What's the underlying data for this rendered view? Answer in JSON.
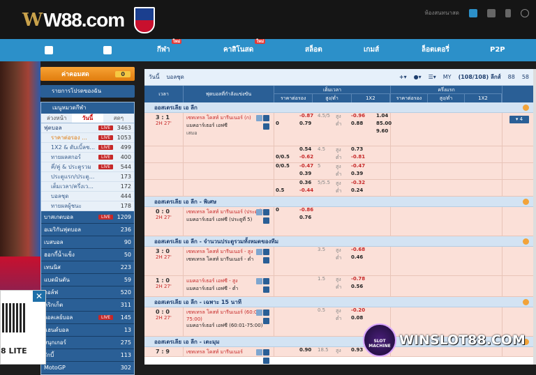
{
  "brand": {
    "name": "W88.com",
    "mark": "W"
  },
  "topbar": {
    "support_text": "ห้องสนทนาสด"
  },
  "nav": {
    "items": [
      {
        "label": "",
        "icon": "home-icon"
      },
      {
        "label": "",
        "icon": "mobile-icon"
      },
      {
        "label": "กีฬา",
        "badge": "ใหม่"
      },
      {
        "label": "คาสิโนสด",
        "badge": "ใหม่"
      },
      {
        "label": "สล็อต"
      },
      {
        "label": "เกมส์"
      },
      {
        "label": "ล็อตเตอรี่"
      },
      {
        "label": "P2P"
      }
    ]
  },
  "sidebar": {
    "balance_label": "ค่าคอมสด",
    "balance_count": "0",
    "fav_label": "รายการโปรดของฉัน",
    "sports_menu": "เมนูหมวดกีฬา",
    "tabs": [
      "ล่วงหน้า",
      "วันนี้",
      "สดๆ"
    ],
    "items": [
      {
        "name": "ฟุตบอล",
        "live": "LIVE",
        "count": "3463",
        "type": "main"
      },
      {
        "name": "ราคาต่อรอง ...",
        "live": "LIVE",
        "count": "1053",
        "type": "sub-sel"
      },
      {
        "name": "1X2 & ดับเบิ้ลช...",
        "live": "LIVE",
        "count": "499",
        "type": "sub"
      },
      {
        "name": "ทายผลสกอร์",
        "live": "LIVE",
        "count": "400",
        "type": "sub"
      },
      {
        "name": "คี่/คู่ & ประตูรวม",
        "live": "LIVE",
        "count": "544",
        "type": "sub"
      },
      {
        "name": "ประตูแรก/ประตู...",
        "live": "",
        "count": "173",
        "type": "sub"
      },
      {
        "name": "เต็มเวลา/ครึ่งเว...",
        "live": "",
        "count": "172",
        "type": "sub"
      },
      {
        "name": "บอลชุด",
        "live": "",
        "count": "444",
        "type": "sub"
      },
      {
        "name": "ทายผลผู้ชนะ",
        "live": "",
        "count": "178",
        "type": "sub"
      },
      {
        "name": "บาสเกตบอล",
        "live": "LIVE",
        "count": "1209",
        "type": "big"
      },
      {
        "name": "อเมริกันฟุตบอล",
        "live": "",
        "count": "236",
        "type": "big"
      },
      {
        "name": "เบสบอล",
        "live": "",
        "count": "90",
        "type": "big"
      },
      {
        "name": "ฮอกกี้น้ำแข็ง",
        "live": "",
        "count": "50",
        "type": "big"
      },
      {
        "name": "เทนนิส",
        "live": "",
        "count": "223",
        "type": "big"
      },
      {
        "name": "แบดมินตัน",
        "live": "",
        "count": "59",
        "type": "big"
      },
      {
        "name": "กอล์ฟ",
        "live": "",
        "count": "520",
        "type": "big"
      },
      {
        "name": "คริกเก็ต",
        "live": "",
        "count": "311",
        "type": "big"
      },
      {
        "name": "วอลเลย์บอล",
        "live": "LIVE",
        "count": "145",
        "type": "big"
      },
      {
        "name": "แฮนด์บอล",
        "live": "",
        "count": "13",
        "type": "big"
      },
      {
        "name": "สนุกเกอร์",
        "live": "",
        "count": "275",
        "type": "big"
      },
      {
        "name": "รักบี้",
        "live": "",
        "count": "113",
        "type": "big"
      },
      {
        "name": "MotoGP",
        "live": "",
        "count": "302",
        "type": "big"
      }
    ]
  },
  "promo": {
    "close": "✕",
    "label": "8 LITE"
  },
  "toolbar": {
    "date": "วันนี้",
    "market": "บอลชุด",
    "odds_type": "MY",
    "count": "(108/108) ลีกส์",
    "n1": "88",
    "n2": "58"
  },
  "table_head": {
    "time": "เวลา",
    "match": "ฟุตบอลที่กำลังแข่งขัน",
    "full": "เต็มเวลา",
    "half": "ครึ่งแรก",
    "sub": [
      "ราคาต่อรอง",
      "สูง/ต่ำ",
      "1X2",
      "ราคาต่อรอง",
      "สูง/ต่ำ",
      "1X2"
    ]
  },
  "leagues": [
    {
      "name": "ออสเตรเลีย เอ ลีก",
      "rows": [
        {
          "score": "3 : 1",
          "min": "2H 27'",
          "home": "เซทเทรล โคสท์ มารีนเนอร์ (ก)",
          "away": "แมคอาร์เธอร์ เอฟซี",
          "draw": "เสมอ",
          "lines": [
            {
              "h": "",
              "o": "-0.87",
              "ou": "4.5/5",
              "ous": "สูง",
              "ouo": "-0.96",
              "x": "1.04"
            },
            {
              "h": "0",
              "o": "0.79",
              "ou": "",
              "ous": "ต่ำ",
              "ouo": "0.88",
              "x": "85.00"
            },
            {
              "h": "",
              "o": "",
              "ou": "",
              "ous": "",
              "ouo": "",
              "x": "9.60"
            }
          ],
          "more": "▾ 4",
          "hgt": 48
        },
        {
          "score": "",
          "min": "",
          "home": "",
          "away": "",
          "draw": "",
          "lines": [
            {
              "h": "",
              "o": "0.54",
              "ou": "4.5",
              "ous": "สูง",
              "ouo": "0.73",
              "x": ""
            },
            {
              "h": "0/0.5",
              "o": "-0.62",
              "ou": "",
              "ous": "ต่ำ",
              "ouo": "-0.81",
              "x": ""
            }
          ],
          "more": "",
          "hgt": 24
        },
        {
          "score": "",
          "min": "",
          "home": "",
          "away": "",
          "draw": "",
          "lines": [
            {
              "h": "0/0.5",
              "o": "-0.47",
              "ou": "5",
              "ous": "สูง",
              "ouo": "-0.47",
              "x": ""
            },
            {
              "h": "",
              "o": "0.39",
              "ou": "",
              "ous": "ต่ำ",
              "ouo": "0.39",
              "x": ""
            }
          ],
          "more": "",
          "hgt": 24
        },
        {
          "score": "",
          "min": "",
          "home": "",
          "away": "",
          "draw": "",
          "lines": [
            {
              "h": "",
              "o": "0.36",
              "ou": "5/5.5",
              "ous": "สูง",
              "ouo": "-0.32",
              "x": ""
            },
            {
              "h": "0.5",
              "o": "-0.44",
              "ou": "",
              "ous": "ต่ำ",
              "ouo": "0.24",
              "x": ""
            }
          ],
          "more": "",
          "hgt": 24
        }
      ]
    },
    {
      "name": "ออสเตรเลีย เอ ลีก - พิเศษ",
      "rows": [
        {
          "score": "0 : 0",
          "min": "2H 27'",
          "home": "เซทเทรล โคสท์ มารีนเนอร์ (ประตูที่ 5)",
          "away": "แมคอาร์เธอร์ เอฟซี (ประตูที่ 5)",
          "draw": "",
          "lines": [
            {
              "h": "0",
              "o": "-0.86",
              "ou": "",
              "ous": "",
              "ouo": "",
              "x": ""
            },
            {
              "h": "",
              "o": "0.76",
              "ou": "",
              "ous": "",
              "ouo": "",
              "x": ""
            }
          ],
          "more": "",
          "hgt": 42
        }
      ]
    },
    {
      "name": "ออสเตรเลีย เอ ลีก - จำนวนประตูรวมทั้งหมดของทีม",
      "rows": [
        {
          "score": "3 : 0",
          "min": "2H 27'",
          "home": "เซทเทรล โคสท์ มารีนเนอร์ - สูง",
          "away": "เซทเทรล โคสท์ มารีนเนอร์ - ต่ำ",
          "draw": "",
          "lines": [
            {
              "h": "",
              "o": "",
              "ou": "3.5",
              "ous": "สูง",
              "ouo": "-0.68",
              "x": ""
            },
            {
              "h": "",
              "o": "",
              "ou": "",
              "ous": "ต่ำ",
              "ouo": "0.46",
              "x": ""
            }
          ],
          "more": "",
          "hgt": 42
        },
        {
          "score": "1 : 0",
          "min": "2H 27'",
          "home": "แมคอาร์เธอร์ เอฟซี - สูง",
          "away": "แมคอาร์เธอร์ เอฟซี - ต่ำ",
          "draw": "",
          "lines": [
            {
              "h": "",
              "o": "",
              "ou": "1.5",
              "ous": "สูง",
              "ouo": "-0.78",
              "x": ""
            },
            {
              "h": "",
              "o": "",
              "ou": "",
              "ous": "ต่ำ",
              "ouo": "0.56",
              "x": ""
            }
          ],
          "more": "",
          "hgt": 30
        }
      ]
    },
    {
      "name": "ออสเตรเลีย เอ ลีก - เฉพาะ 15 นาที",
      "rows": [
        {
          "score": "0 : 0",
          "min": "2H 27'",
          "home": "เซทเทรล โคสท์ มารีนเนอร์ (60:01-75:00)",
          "away": "แมคอาร์เธอร์ เอฟซี (60:01-75:00)",
          "draw": "",
          "lines": [
            {
              "h": "",
              "o": "",
              "ou": "0.5",
              "ous": "สูง",
              "ouo": "-0.20",
              "x": ""
            },
            {
              "h": "",
              "o": "",
              "ou": "",
              "ous": "ต่ำ",
              "ouo": "0.08",
              "x": ""
            }
          ],
          "more": "",
          "hgt": 42
        }
      ]
    },
    {
      "name": "ออสเตรเลีย เอ ลีก - เตะมุม",
      "rows": [
        {
          "score": "7 : 9",
          "min": "",
          "home": "เซทเทรล โคสท์ มารีนเนอร์",
          "away": "",
          "draw": "",
          "lines": [
            {
              "h": "",
              "o": "0.90",
              "ou": "18.5",
              "ous": "สูง",
              "ouo": "0.93",
              "x": ""
            }
          ],
          "more": "",
          "hgt": 14
        }
      ]
    }
  ],
  "watermark": {
    "badge": "SLOT MACHINE",
    "text": "WINSLOT88.COM"
  }
}
